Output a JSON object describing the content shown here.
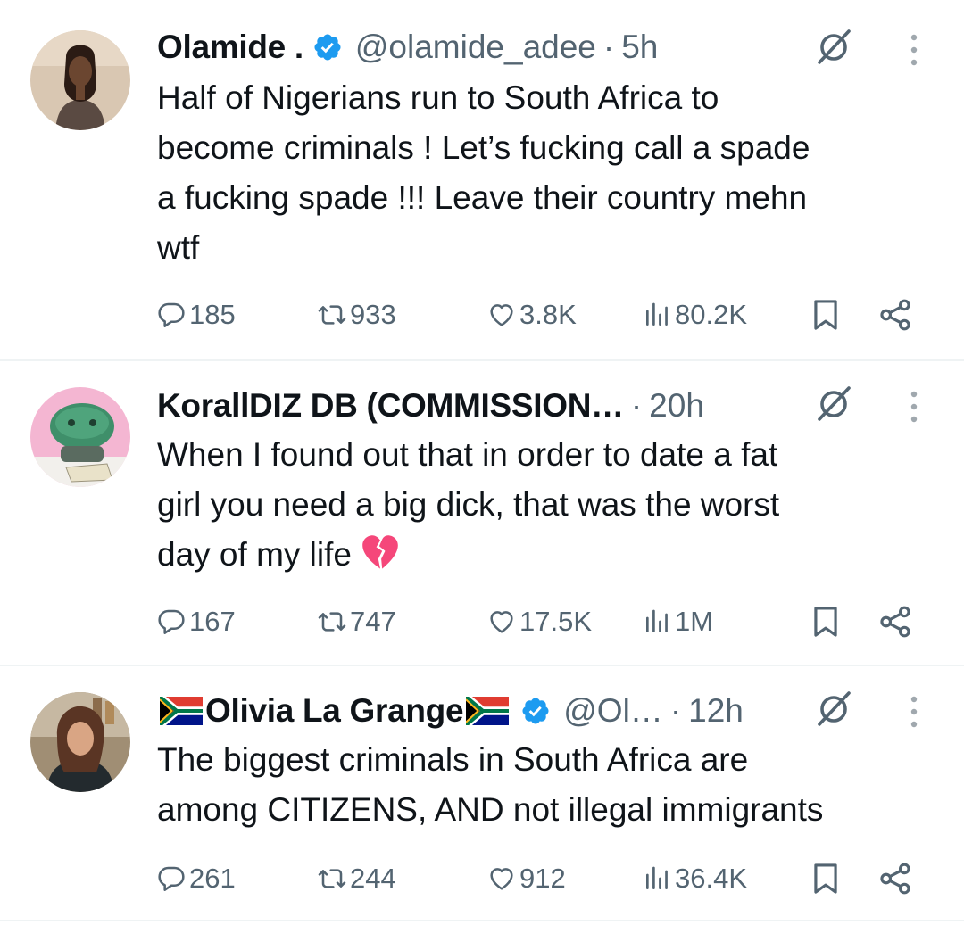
{
  "colors": {
    "text": "#0f1419",
    "muted": "#536471",
    "verified": "#1d9bf0",
    "divider": "#eff3f4"
  },
  "tweets": [
    {
      "name": "Olamide .",
      "verified": true,
      "handle": "@olamide_adee",
      "time": "5h",
      "text": "Half of Nigerians run to South Africa to\nbecome criminals ! Let’s fucking call a spade\na fucking spade !!! Leave their country mehn\nwtf",
      "replies": "185",
      "reposts": "933",
      "likes": "3.8K",
      "views": "80.2K"
    },
    {
      "name": "KorallDIZ DB (COMMISSION…",
      "verified": false,
      "handle": "",
      "time": "20h",
      "text": "When I found out that in order to date a fat\ngirl you need a big dick, that was the worst\nday of my life",
      "emoji": "broken-heart-icon",
      "replies": "167",
      "reposts": "747",
      "likes": "17.5K",
      "views": "1M"
    },
    {
      "name": "Olivia La Grange",
      "verified": true,
      "handle": "@Ol…",
      "time": "12h",
      "text": "The biggest criminals in South Africa are\namong CITIZENS, AND not illegal immigrants",
      "replies": "261",
      "reposts": "244",
      "likes": "912",
      "views": "36.4K"
    }
  ]
}
